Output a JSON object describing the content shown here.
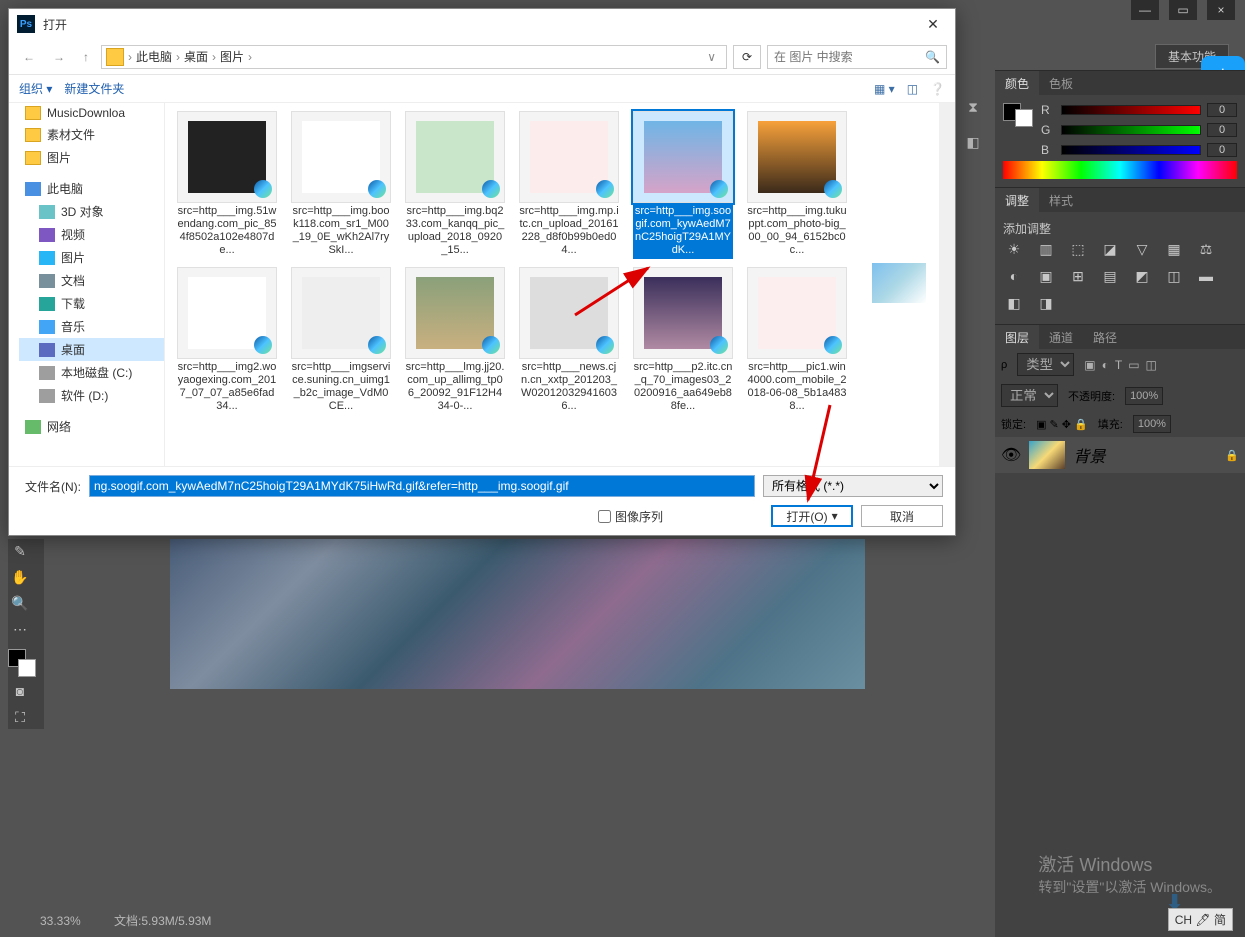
{
  "ps": {
    "window_controls": {
      "min": "—",
      "max": "▭",
      "close": "×"
    },
    "basic_button": "基本功能",
    "zoom": "33.33%",
    "doc_info": "文档:5.93M/5.93M",
    "activate_title": "激活 Windows",
    "activate_sub": "转到\"设置\"以激活 Windows。",
    "ime": "CH 🖊 简"
  },
  "panels": {
    "color_tab": "颜色",
    "swatch_tab": "色板",
    "rgb": {
      "r": "R",
      "g": "G",
      "b": "B",
      "r_val": "0",
      "g_val": "0",
      "b_val": "0"
    },
    "adjust_tab": "调整",
    "style_tab": "样式",
    "add_adjust": "添加调整",
    "layers_tab": "图层",
    "channels_tab": "通道",
    "paths_tab": "路径",
    "kind_label": "类型",
    "blend_normal": "正常",
    "opacity_label": "不透明度:",
    "opacity_val": "100%",
    "lock_label": "锁定:",
    "fill_label": "填充:",
    "fill_val": "100%",
    "layer_name": "背景"
  },
  "dialog": {
    "title": "打开",
    "breadcrumb": [
      "此电脑",
      "桌面",
      "图片"
    ],
    "search_placeholder": "在 图片 中搜索",
    "organize": "组织 ▾",
    "new_folder": "新建文件夹",
    "tree": {
      "music_downloads": "MusicDownloa",
      "material": "素材文件",
      "pic": "图片",
      "computer": "此电脑",
      "threed": "3D 对象",
      "video": "视频",
      "images": "图片",
      "documents": "文档",
      "downloads": "下载",
      "music": "音乐",
      "desktop": "桌面",
      "disk_c": "本地磁盘 (C:)",
      "disk_d": "软件 (D:)",
      "network": "网络"
    },
    "files": [
      {
        "name": "src=http___img.51wendang.com_pic_854f8502a102e4807de...",
        "thumb": "kb",
        "sel": false
      },
      {
        "name": "src=http___img.book118.com_sr1_M00_19_0E_wKh2Al7rySkI...",
        "thumb": "doc",
        "sel": false
      },
      {
        "name": "src=http___img.bq233.com_kanqq_pic_upload_2018_0920_15...",
        "thumb": "green",
        "sel": false
      },
      {
        "name": "src=http___img.mp.itc.cn_upload_20161228_d8f0b99b0ed04...",
        "thumb": "idcard",
        "sel": false
      },
      {
        "name": "src=http___img.soogif.com_kywAedM7nC25hoigT29A1MYdK...",
        "thumb": "anime",
        "sel": true
      },
      {
        "name": "src=http___img.tukuppt.com_photo-big_00_00_94_6152bc0c...",
        "thumb": "sunset",
        "sel": false
      },
      {
        "name": "src=http___img2.woyaogexing.com_2017_07_07_a85e6fad34...",
        "thumb": "text",
        "sel": false
      },
      {
        "name": "src=http___imgservice.suning.cn_uimg1_b2c_image_VdM0CE...",
        "thumb": "tshirt",
        "sel": false
      },
      {
        "name": "src=http___lmg.jj20.com_up_allimg_tp06_20092_91F12H434-0-...",
        "thumb": "land",
        "sel": false
      },
      {
        "name": "src=http___news.cjn.cn_xxtp_201203_W020120329416036...",
        "thumb": "cat",
        "sel": false
      },
      {
        "name": "src=http___p2.itc.cn_q_70_images03_20200916_aa649eb88fe...",
        "thumb": "nebula",
        "sel": false
      },
      {
        "name": "src=http___pic1.win4000.com_mobile_2018-06-08_5b1a4838...",
        "thumb": "pink",
        "sel": false
      }
    ],
    "filename_label": "文件名(N):",
    "filename_value": "ng.soogif.com_kywAedM7nC25hoigT29A1MYdK75iHwRd.gif&refer=http___img.soogif.gif",
    "filetype": "所有格式 (*.*)",
    "seq": "图像序列",
    "open_btn": "打开(O)",
    "cancel_btn": "取消"
  }
}
